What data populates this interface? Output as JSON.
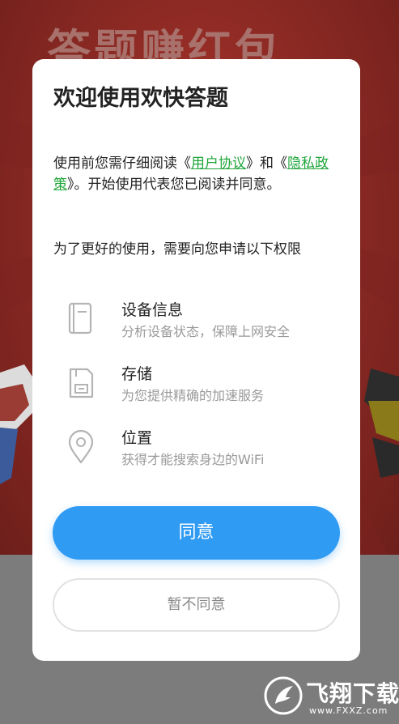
{
  "background": {
    "title": "答题赚红包"
  },
  "dialog": {
    "title": "欢迎使用欢快答题",
    "intro": {
      "part1": "使用前您需仔细阅读《",
      "user_agreement": "用户协议",
      "part2": "》和《",
      "privacy_policy": "隐私政策",
      "part3": "》。开始使用代表您已阅读并同意。"
    },
    "request_text": "为了更好的使用，需要向您申请以下权限",
    "permissions": [
      {
        "icon": "device-icon",
        "name": "设备信息",
        "desc": "分析设备状态，保障上网安全"
      },
      {
        "icon": "storage-icon",
        "name": "存储",
        "desc": "为您提供精确的加速服务"
      },
      {
        "icon": "location-icon",
        "name": "位置",
        "desc": "获得才能搜索身边的WiFi"
      }
    ],
    "agree_label": "同意",
    "decline_label": "暂不同意"
  },
  "watermark": {
    "text": "飞翔下载",
    "url": "www.FXXZ.com"
  },
  "colors": {
    "primary": "#2f9bf3",
    "link": "#20a63a"
  }
}
